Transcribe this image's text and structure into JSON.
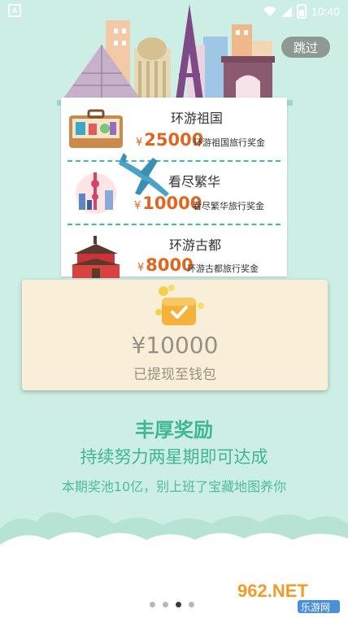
{
  "status_bar": {
    "time": "10:40",
    "notification_letter": "A"
  },
  "skip_button": "跳过",
  "prizes": [
    {
      "title": "环游祖国",
      "currency": "¥",
      "amount": "25000",
      "description": "环游祖国旅行奖金"
    },
    {
      "title": "看尽繁华",
      "currency": "¥",
      "amount": "10000",
      "description": "看尽繁华旅行奖金"
    },
    {
      "title": "环游古都",
      "currency": "¥",
      "amount": "8000",
      "description": "环游古都旅行奖金"
    }
  ],
  "wallet": {
    "amount": "¥10000",
    "note": "已提现至钱包"
  },
  "headline": "丰厚奖励",
  "subline": "持续努力两星期即可达成",
  "tagline": "本期奖池10亿，别上班了宝藏地图养你",
  "pagination": {
    "total": 4,
    "active": 3
  },
  "watermark": {
    "logo_text": "962.NET",
    "sub_text": "乐游网"
  },
  "colors": {
    "background": "#cdeee5",
    "accent_green": "#3fb790",
    "prize_orange": "#e0651f",
    "wallet_card": "#f9efd9",
    "skip_button": "#8e9894"
  }
}
